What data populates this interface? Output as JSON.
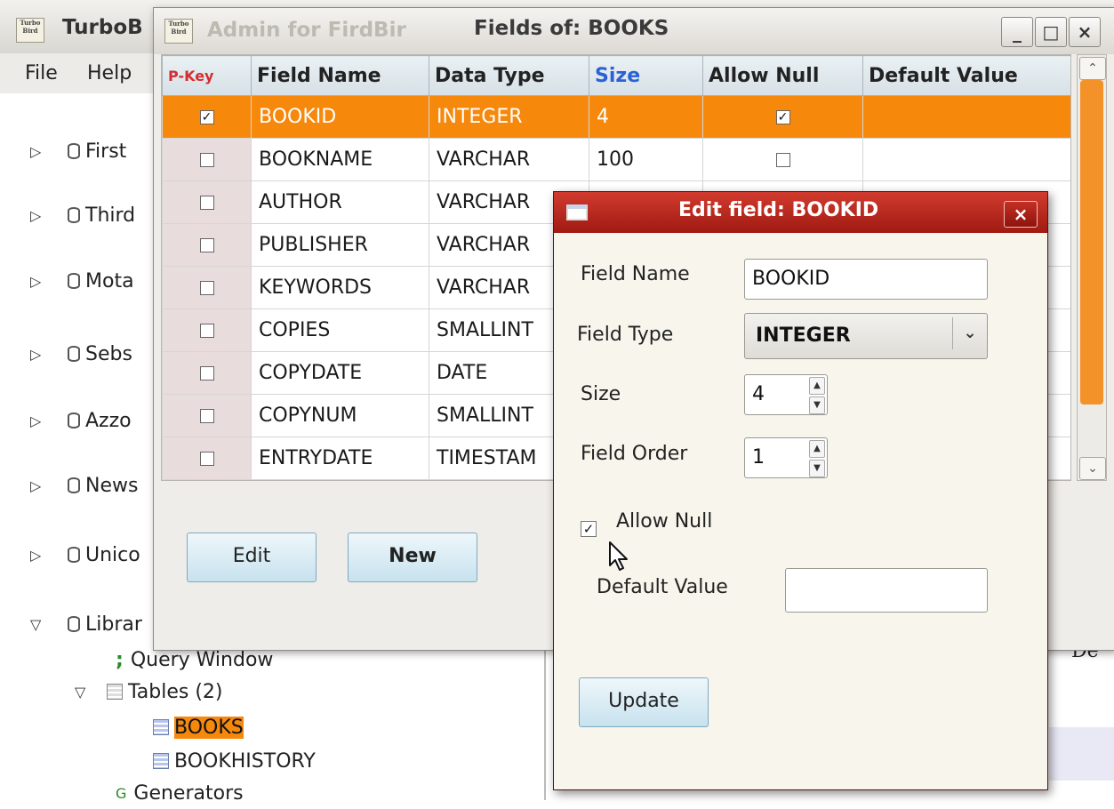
{
  "main_window": {
    "title": "TurboB",
    "app_icon_text": "Turbo Bird",
    "menu": [
      "File",
      "Help"
    ],
    "tree": [
      {
        "label": "First",
        "expanded": false
      },
      {
        "label": "Third",
        "expanded": false
      },
      {
        "label": "Mota",
        "expanded": false
      },
      {
        "label": "Sebs",
        "expanded": false
      },
      {
        "label": "Azzo",
        "expanded": false
      },
      {
        "label": "News",
        "expanded": false
      },
      {
        "label": "Unico",
        "expanded": false
      },
      {
        "label": "Librar",
        "expanded": true
      }
    ],
    "query_window_label": "Query Window",
    "tables_label": "Tables (2)",
    "tables": [
      "BOOKS",
      "BOOKHISTORY"
    ],
    "generators_label": "Generators",
    "right_fragment": "De"
  },
  "fields_window": {
    "ghost_title": "Admin for FirdBir",
    "title": "Fields of: BOOKS",
    "controls": {
      "minimize": "_",
      "maximize": "□",
      "close": "×"
    },
    "columns": [
      "P-Key",
      "Field Name",
      "Data Type",
      "Size",
      "Allow Null",
      "Default Value"
    ],
    "rows": [
      {
        "pkey": true,
        "name": "BOOKID",
        "type": "INTEGER",
        "size": "4",
        "allow_null": true,
        "default": "",
        "selected": true
      },
      {
        "pkey": false,
        "name": "BOOKNAME",
        "type": "VARCHAR",
        "size": "100",
        "allow_null": false,
        "default": ""
      },
      {
        "pkey": false,
        "name": "AUTHOR",
        "type": "VARCHAR",
        "size": "",
        "allow_null": null,
        "default": ""
      },
      {
        "pkey": false,
        "name": "PUBLISHER",
        "type": "VARCHAR",
        "size": "",
        "allow_null": null,
        "default": ""
      },
      {
        "pkey": false,
        "name": "KEYWORDS",
        "type": "VARCHAR",
        "size": "",
        "allow_null": null,
        "default": ""
      },
      {
        "pkey": false,
        "name": "COPIES",
        "type": "SMALLINT",
        "size": "",
        "allow_null": null,
        "default": ""
      },
      {
        "pkey": false,
        "name": "COPYDATE",
        "type": "DATE",
        "size": "",
        "allow_null": null,
        "default": ""
      },
      {
        "pkey": false,
        "name": "COPYNUM",
        "type": "SMALLINT",
        "size": "",
        "allow_null": null,
        "default": ""
      },
      {
        "pkey": false,
        "name": "ENTRYDATE",
        "type": "TIMESTAM",
        "size": "",
        "allow_null": null,
        "default": ""
      }
    ],
    "edit_label": "Edit",
    "new_label": "New"
  },
  "edit_dialog": {
    "title": "Edit field: BOOKID",
    "close": "×",
    "field_name_label": "Field Name",
    "field_name_value": "BOOKID",
    "field_type_label": "Field Type",
    "field_type_value": "INTEGER",
    "size_label": "Size",
    "size_value": "4",
    "field_order_label": "Field Order",
    "field_order_value": "1",
    "allow_null_label": "Allow Null",
    "allow_null_checked": true,
    "default_value_label": "Default Value",
    "default_value": "",
    "update_label": "Update"
  },
  "colors": {
    "selection": "#f6880c",
    "dialog_title": "#b8241a",
    "pkey_header": "#d03030",
    "size_header": "#2a62d6"
  }
}
